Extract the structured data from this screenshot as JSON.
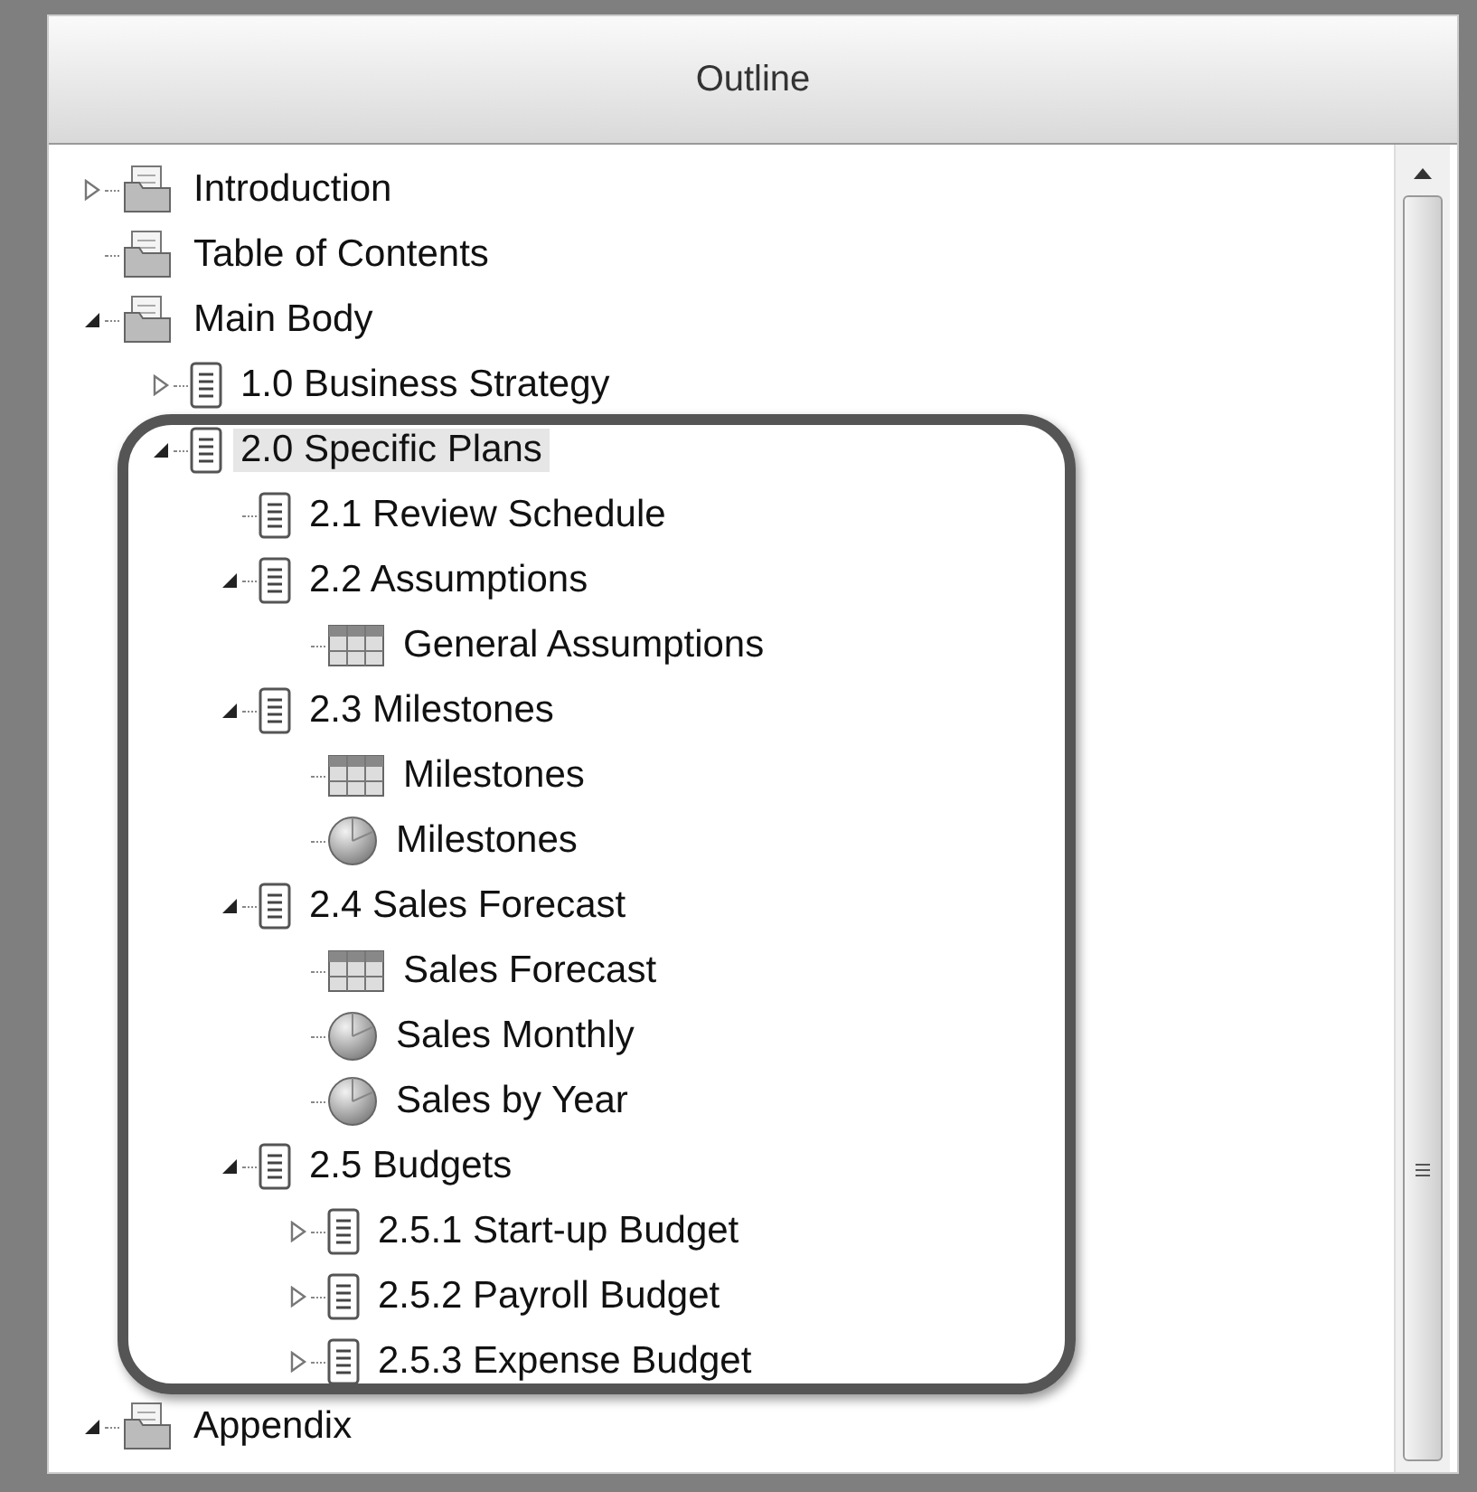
{
  "panel": {
    "title": "Outline"
  },
  "tree": [
    {
      "label": "Introduction",
      "kind": "folder",
      "expanded": false,
      "selected": false
    },
    {
      "label": "Table of Contents",
      "kind": "folder",
      "selected": false
    },
    {
      "label": "Main Body",
      "kind": "folder",
      "expanded": true,
      "selected": false,
      "children": [
        {
          "label": "1.0 Business Strategy",
          "kind": "page",
          "expanded": false,
          "selected": false
        },
        {
          "label": "2.0 Specific Plans",
          "kind": "page",
          "expanded": true,
          "selected": true,
          "children": [
            {
              "label": "2.1 Review Schedule",
              "kind": "page",
              "selected": false
            },
            {
              "label": "2.2 Assumptions",
              "kind": "page",
              "expanded": true,
              "selected": false,
              "children": [
                {
                  "label": "General Assumptions",
                  "kind": "table",
                  "selected": false
                }
              ]
            },
            {
              "label": "2.3 Milestones",
              "kind": "page",
              "expanded": true,
              "selected": false,
              "children": [
                {
                  "label": "Milestones",
                  "kind": "table",
                  "selected": false
                },
                {
                  "label": "Milestones",
                  "kind": "chart",
                  "selected": false
                }
              ]
            },
            {
              "label": "2.4 Sales Forecast",
              "kind": "page",
              "expanded": true,
              "selected": false,
              "children": [
                {
                  "label": "Sales Forecast",
                  "kind": "table",
                  "selected": false
                },
                {
                  "label": "Sales Monthly",
                  "kind": "chart",
                  "selected": false
                },
                {
                  "label": "Sales by Year",
                  "kind": "chart",
                  "selected": false
                }
              ]
            },
            {
              "label": "2.5 Budgets",
              "kind": "page",
              "expanded": true,
              "selected": false,
              "children": [
                {
                  "label": "2.5.1 Start-up Budget",
                  "kind": "page",
                  "expanded": false,
                  "selected": false
                },
                {
                  "label": "2.5.2 Payroll Budget",
                  "kind": "page",
                  "expanded": false,
                  "selected": false
                },
                {
                  "label": "2.5.3 Expense Budget",
                  "kind": "page",
                  "expanded": false,
                  "selected": false
                }
              ]
            }
          ]
        }
      ]
    },
    {
      "label": "Appendix",
      "kind": "folder",
      "expanded": true,
      "selected": false
    }
  ]
}
